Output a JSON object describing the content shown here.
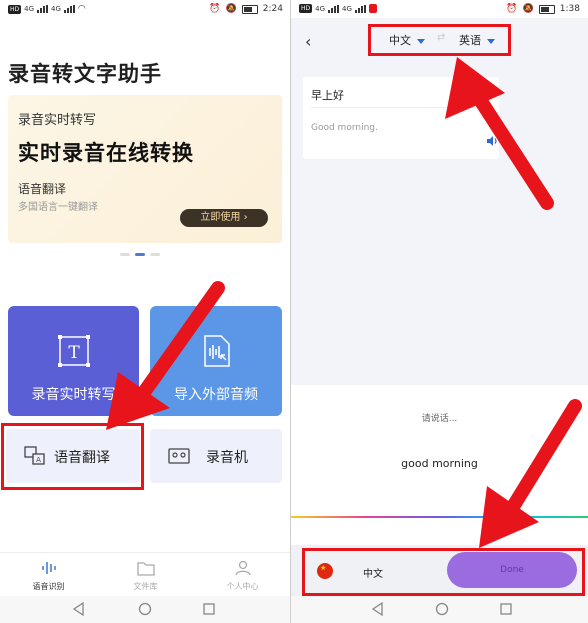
{
  "left": {
    "status": {
      "carrier_chip": "HD",
      "net1": "4G",
      "net2": "4G",
      "time": "2:24"
    },
    "app_title": "录音转文字助手",
    "banner": {
      "small_title": "录音实时转写",
      "big_title": "实时录音在线转换",
      "sub_title": "语音翻译",
      "description": "多国语言一键翻译",
      "button_label": "立即使用 ›"
    },
    "carousel": {
      "count": 3,
      "active_index": 1
    },
    "features": [
      {
        "label": "录音实时转写",
        "icon": "text-frame-icon"
      },
      {
        "label": "导入外部音频",
        "icon": "audio-import-icon"
      }
    ],
    "tools": [
      {
        "label": "语音翻译",
        "icon": "translate-icon"
      },
      {
        "label": "录音机",
        "icon": "cassette-icon"
      }
    ],
    "tabs": [
      {
        "label": "语音识别",
        "icon": "waveform-icon",
        "active": true
      },
      {
        "label": "文件库",
        "icon": "folder-icon",
        "active": false
      },
      {
        "label": "个人中心",
        "icon": "person-icon",
        "active": false
      }
    ]
  },
  "right": {
    "status": {
      "carrier_chip": "HD",
      "net1": "4G",
      "net2": "4G",
      "time": "1:38"
    },
    "source_language": "中文",
    "target_language": "英语",
    "swap_icon": "⇄",
    "source_text": "早上好",
    "translated_text": "Good morning.",
    "prompt": "请说话...",
    "recognized_text": "good morning",
    "bottom_language": "中文",
    "done_label": "Done"
  },
  "colors": {
    "accent_blue": "#2a6ad8",
    "card_purple": "#5a5fd6",
    "card_blue": "#5b97e6",
    "done_purple": "#9a6ce0",
    "annotation_red": "#e8141b"
  }
}
